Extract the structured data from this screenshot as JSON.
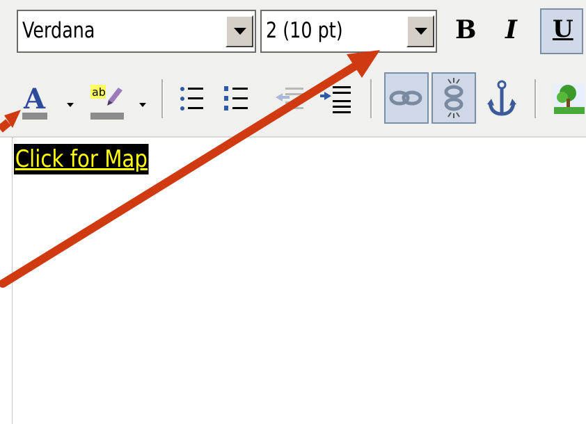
{
  "toolbar": {
    "font_select": {
      "value": "Verdana"
    },
    "size_select": {
      "value": "2 (10 pt)"
    },
    "bold_label": "B",
    "italic_label": "I",
    "underline_label": "U",
    "font_color_label": "A",
    "highlight_label": "ab",
    "icons": [
      "font-color-icon",
      "highlight-color-icon",
      "bulleted-list-icon",
      "numbered-list-icon",
      "outdent-icon",
      "indent-icon",
      "link-icon",
      "unlink-icon",
      "anchor-icon",
      "image-icon"
    ]
  },
  "editor": {
    "link_text": "Click for Map",
    "link_text_color": "#ffff00",
    "link_bg_color": "#000000"
  },
  "annotations": {
    "arrow_color": "#d03a10"
  }
}
